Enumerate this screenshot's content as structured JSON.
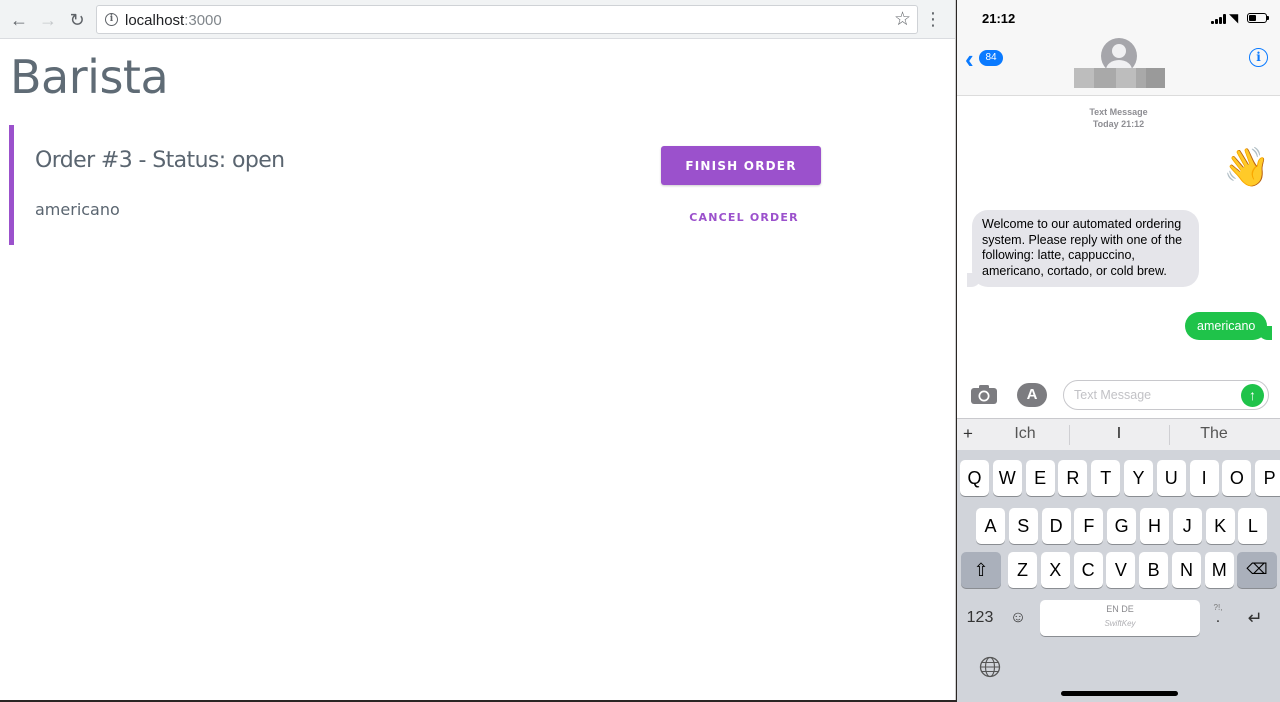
{
  "browser": {
    "url_host": "localhost",
    "url_port": ":3000",
    "page_title": "Barista",
    "order": {
      "heading": "Order #3 - Status: open",
      "item": "americano",
      "finish_label": "FINISH ORDER",
      "cancel_label": "CANCEL ORDER"
    },
    "accent_color": "#9b51cc"
  },
  "phone": {
    "time": "21:12",
    "back_badge": "84",
    "thread_type": "Text Message",
    "thread_time": "Today 21:12",
    "messages": [
      {
        "from": "me",
        "text": "👋"
      },
      {
        "from": "them",
        "text": "Welcome to our automated ordering system. Please reply with one of the following: latte, cappuccino, americano, cortado, or cold brew."
      },
      {
        "from": "me",
        "text": "americano"
      }
    ],
    "composer_placeholder": "Text Message",
    "keyboard": {
      "suggestions": [
        "Ich",
        "I",
        "The"
      ],
      "row1": [
        "Q",
        "W",
        "E",
        "R",
        "T",
        "Y",
        "U",
        "I",
        "O",
        "P"
      ],
      "row2": [
        "A",
        "S",
        "D",
        "F",
        "G",
        "H",
        "J",
        "K",
        "L"
      ],
      "row3": [
        "Z",
        "X",
        "C",
        "V",
        "B",
        "N",
        "M"
      ],
      "numbers_key": "123",
      "space_language": "EN DE",
      "space_brand": "SwiftKey",
      "punct_key": "?!,",
      "punct_key_main": "."
    },
    "colors": {
      "ios_blue": "#0a7aff",
      "sms_green": "#1fc34a",
      "incoming_gray": "#e5e5ea"
    }
  }
}
